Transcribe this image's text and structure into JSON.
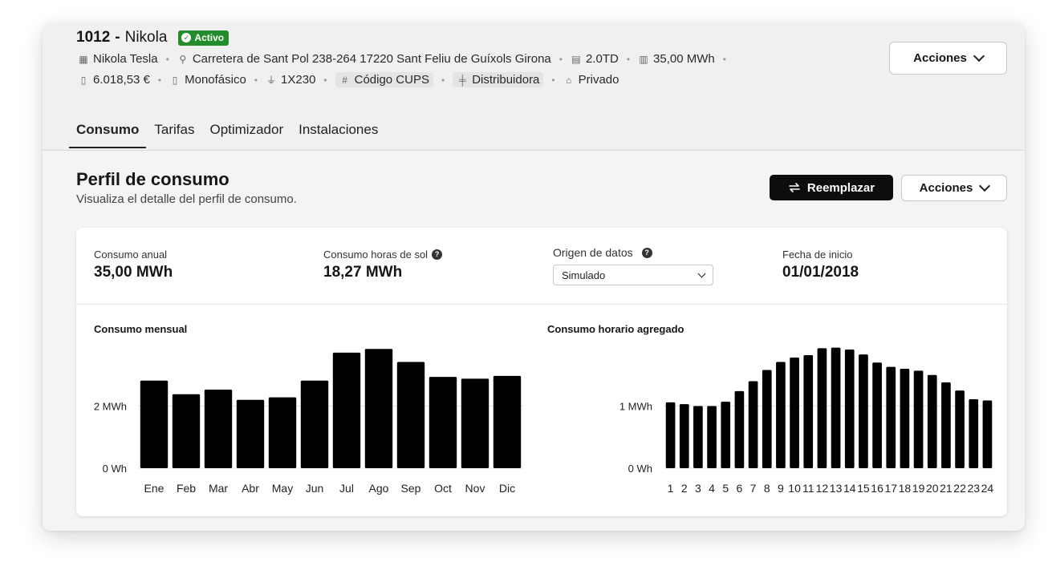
{
  "header": {
    "id": "1012",
    "dash": "-",
    "name": "Nikola",
    "badge": "Activo",
    "meta_row1": [
      {
        "icon": "building-icon",
        "glyph": "▦",
        "text": "Nikola Tesla"
      },
      {
        "icon": "location-pin-icon",
        "glyph": "⚲",
        "text": "Carretera de Sant Pol 238-264 17220 Sant Feliu de Guíxols Girona"
      },
      {
        "icon": "tariff-icon",
        "glyph": "▤",
        "text": "2.0TD"
      },
      {
        "icon": "bar-chart-icon",
        "glyph": "▥",
        "text": "35,00 MWh"
      }
    ],
    "meta_row2": [
      {
        "icon": "money-icon",
        "glyph": "▯",
        "text": "6.018,53 €",
        "chip": false
      },
      {
        "icon": "meter-icon",
        "glyph": "▯",
        "text": "Monofásico",
        "chip": false
      },
      {
        "icon": "plug-icon",
        "glyph": "⏚",
        "text": "1X230",
        "chip": false
      },
      {
        "icon": "hash-icon",
        "glyph": "#",
        "text": "Código CUPS",
        "chip": true
      },
      {
        "icon": "power-line-icon",
        "glyph": "╪",
        "text": "Distribuidora",
        "chip": true
      },
      {
        "icon": "house-icon",
        "glyph": "⌂",
        "text": "Privado",
        "chip": false
      }
    ],
    "actions_label": "Acciones"
  },
  "tabs": [
    {
      "label": "Consumo",
      "active": true
    },
    {
      "label": "Tarifas",
      "active": false
    },
    {
      "label": "Optimizador",
      "active": false
    },
    {
      "label": "Instalaciones",
      "active": false
    }
  ],
  "section": {
    "title": "Perfil de consumo",
    "subtitle": "Visualiza el detalle del perfil de consumo.",
    "replace_label": "Reemplazar",
    "actions_label": "Acciones"
  },
  "stats": {
    "annual_label": "Consumo anual",
    "annual_value": "35,00 MWh",
    "sun_label": "Consumo horas de sol",
    "sun_value": "18,27 MWh",
    "origin_label": "Origen de datos",
    "origin_value": "Simulado",
    "start_label": "Fecha de inicio",
    "start_value": "01/01/2018"
  },
  "chart_data": [
    {
      "type": "bar",
      "title": "Consumo mensual",
      "categories": [
        "Ene",
        "Feb",
        "Mar",
        "Abr",
        "May",
        "Jun",
        "Jul",
        "Ago",
        "Sep",
        "Oct",
        "Nov",
        "Dic"
      ],
      "values": [
        2.82,
        2.38,
        2.53,
        2.2,
        2.28,
        2.82,
        3.72,
        3.84,
        3.42,
        2.94,
        2.88,
        2.97
      ],
      "yticks": [
        {
          "value": 0,
          "label": "0 Wh"
        },
        {
          "value": 2,
          "label": "2 MWh"
        }
      ],
      "ylim": [
        0,
        4
      ],
      "grid": true
    },
    {
      "type": "bar",
      "title": "Consumo horario agregado",
      "categories": [
        "1",
        "2",
        "3",
        "4",
        "5",
        "6",
        "7",
        "8",
        "9",
        "10",
        "11",
        "12",
        "13",
        "14",
        "15",
        "16",
        "17",
        "18",
        "19",
        "20",
        "21",
        "22",
        "23",
        "24"
      ],
      "values": [
        1.06,
        1.03,
        1.0,
        1.0,
        1.07,
        1.24,
        1.4,
        1.58,
        1.71,
        1.78,
        1.82,
        1.93,
        1.94,
        1.91,
        1.83,
        1.7,
        1.63,
        1.6,
        1.57,
        1.5,
        1.38,
        1.25,
        1.11,
        1.09
      ],
      "yticks": [
        {
          "value": 0,
          "label": "0 Wh"
        },
        {
          "value": 1,
          "label": "1 MWh"
        }
      ],
      "ylim": [
        0,
        2
      ],
      "grid": true
    }
  ]
}
